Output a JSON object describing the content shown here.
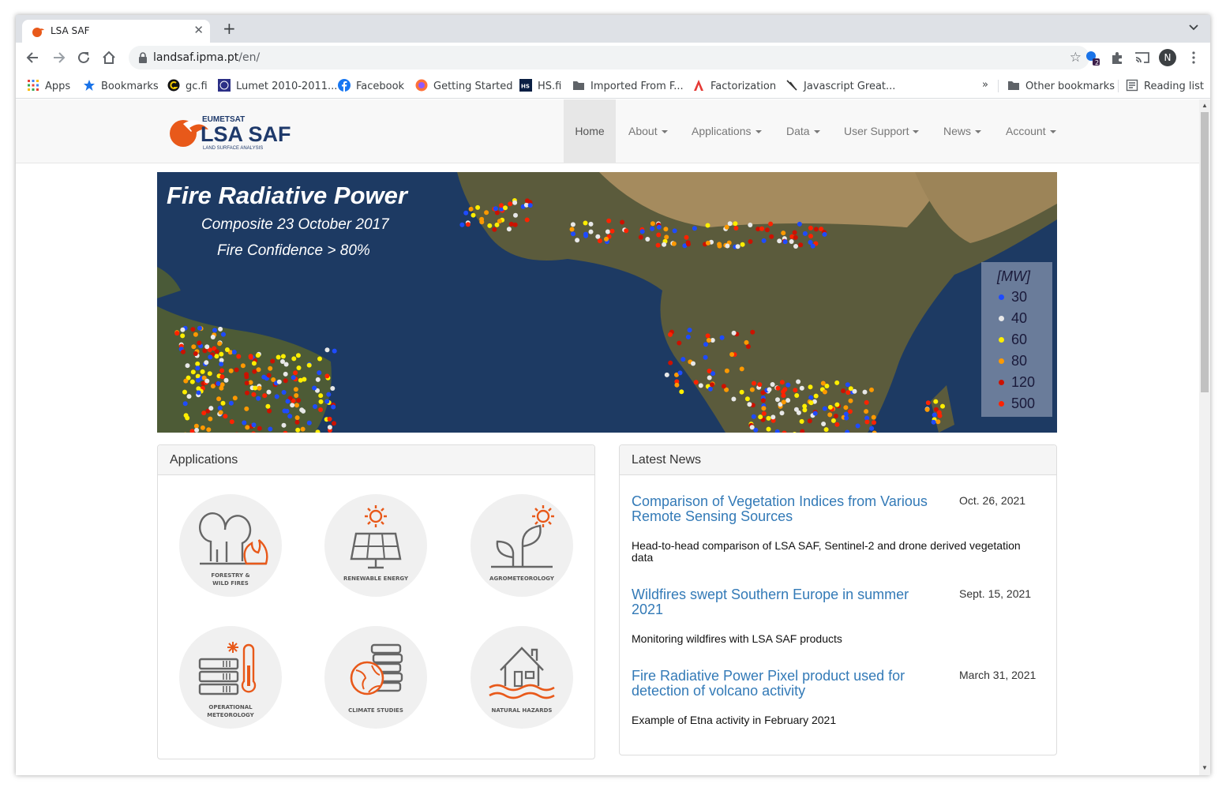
{
  "browser": {
    "tab_title": "LSA SAF",
    "tab_close": "✕",
    "new_tab": "+",
    "url_host": "landsaf.ipma.pt",
    "url_path": "/en/",
    "profile_initial": "N",
    "extension_badge": "2",
    "bookmarks": [
      {
        "label": "Apps",
        "icon": "apps-grid-icon"
      },
      {
        "label": "Bookmarks",
        "icon": "star-icon"
      },
      {
        "label": "gc.fi",
        "icon": "gc-icon"
      },
      {
        "label": "Lumet 2010-2011...",
        "icon": "lumet-icon"
      },
      {
        "label": "Facebook",
        "icon": "facebook-icon"
      },
      {
        "label": "Getting Started",
        "icon": "firefox-icon"
      },
      {
        "label": "HS.fi",
        "icon": "hs-icon"
      },
      {
        "label": "Imported From F...",
        "icon": "folder-icon"
      },
      {
        "label": "Factorization",
        "icon": "factorization-icon"
      },
      {
        "label": "Javascript Great...",
        "icon": "javascript-icon"
      }
    ],
    "overflow": "»",
    "other_bookmarks": "Other bookmarks",
    "reading_list": "Reading list"
  },
  "site": {
    "logo_top": "EUMETSAT",
    "logo_main": "LSA SAF",
    "logo_sub": "LAND SURFACE ANALYSIS",
    "nav": [
      {
        "label": "Home",
        "active": true,
        "dropdown": false
      },
      {
        "label": "About",
        "active": false,
        "dropdown": true
      },
      {
        "label": "Applications",
        "active": false,
        "dropdown": true
      },
      {
        "label": "Data",
        "active": false,
        "dropdown": true
      },
      {
        "label": "User Support",
        "active": false,
        "dropdown": true
      },
      {
        "label": "News",
        "active": false,
        "dropdown": true
      },
      {
        "label": "Account",
        "active": false,
        "dropdown": true
      }
    ]
  },
  "banner": {
    "title": "Fire Radiative Power",
    "line1": "Composite 23 October 2017",
    "line2": "Fire Confidence > 80%",
    "legend_unit": "[MW]",
    "legend": [
      {
        "value": "30",
        "color": "#1e4bff"
      },
      {
        "value": "40",
        "color": "#e8e8e8"
      },
      {
        "value": "60",
        "color": "#ffee00"
      },
      {
        "value": "80",
        "color": "#ff9900"
      },
      {
        "value": "120",
        "color": "#cc1100"
      },
      {
        "value": "500",
        "color": "#ff2200"
      }
    ]
  },
  "applications": {
    "heading": "Applications",
    "items": [
      {
        "caption_1": "FORESTRY &",
        "caption_2": "WILD FIRES",
        "icon": "forestry-wildfires-icon"
      },
      {
        "caption_1": "RENEWABLE ENERGY",
        "caption_2": "",
        "icon": "renewable-energy-icon"
      },
      {
        "caption_1": "AGROMETEOROLOGY",
        "caption_2": "",
        "icon": "agrometeorology-icon"
      },
      {
        "caption_1": "OPERATIONAL",
        "caption_2": "METEOROLOGY",
        "icon": "operational-meteorology-icon"
      },
      {
        "caption_1": "CLIMATE STUDIES",
        "caption_2": "",
        "icon": "climate-studies-icon"
      },
      {
        "caption_1": "NATURAL HAZARDS",
        "caption_2": "",
        "icon": "natural-hazards-icon"
      }
    ]
  },
  "news": {
    "heading": "Latest News",
    "items": [
      {
        "title": "Comparison of Vegetation Indices from Various Remote Sensing Sources",
        "date": "Oct. 26, 2021",
        "desc": "Head-to-head comparison of LSA SAF, Sentinel-2 and drone derived vegetation data"
      },
      {
        "title": "Wildfires swept Southern Europe in summer 2021",
        "date": "Sept. 15, 2021",
        "desc": "Monitoring wildfires with LSA SAF products"
      },
      {
        "title": "Fire Radiative Power Pixel product used for detection of volcano activity",
        "date": "March 31, 2021",
        "desc": "Example of Etna activity in February 2021"
      }
    ]
  },
  "colors": {
    "accent": "#e8591a",
    "link": "#337ab7",
    "navy": "#1f3a6b"
  }
}
